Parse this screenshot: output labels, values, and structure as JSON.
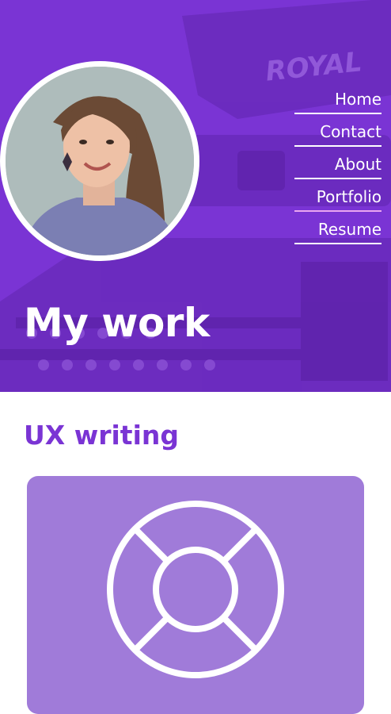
{
  "header": {
    "title": "My work",
    "background_text": "ROYAL"
  },
  "nav": {
    "items": [
      {
        "label": "Home"
      },
      {
        "label": "Contact"
      },
      {
        "label": "About"
      },
      {
        "label": "Portfolio",
        "active": true
      },
      {
        "label": "Resume"
      }
    ]
  },
  "section": {
    "title": "UX writing"
  },
  "card": {
    "icon": "lifebuoy-icon"
  },
  "colors": {
    "brand_purple": "#7a34d4",
    "card_purple": "#a07bd9",
    "active_underline": "#e9a6f0",
    "white": "#ffffff"
  }
}
